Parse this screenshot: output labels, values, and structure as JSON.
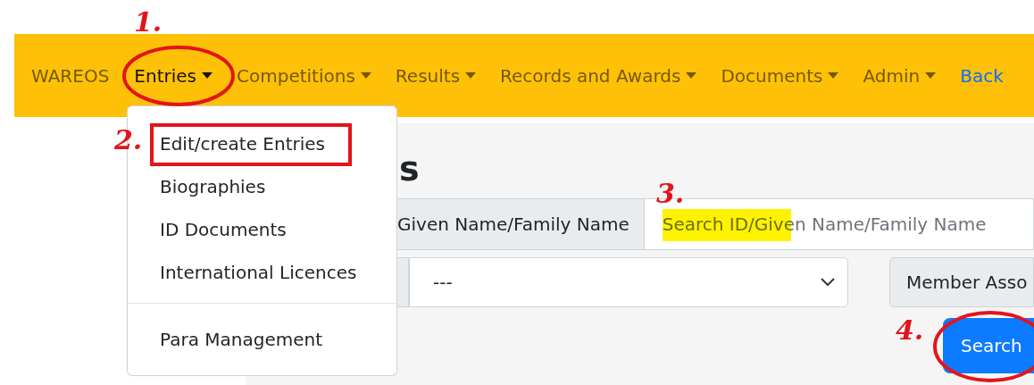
{
  "navbar": {
    "brand": "WAREOS",
    "items": [
      {
        "label": "Entries",
        "kind": "dropdown",
        "selected": true
      },
      {
        "label": "Competitions",
        "kind": "dropdown",
        "selected": false
      },
      {
        "label": "Results",
        "kind": "dropdown",
        "selected": false
      },
      {
        "label": "Records and Awards",
        "kind": "dropdown",
        "selected": false
      },
      {
        "label": "Documents",
        "kind": "dropdown",
        "selected": false
      },
      {
        "label": "Admin",
        "kind": "dropdown",
        "selected": false
      },
      {
        "label": "Back",
        "kind": "link",
        "selected": false
      }
    ]
  },
  "dropdown_menu": {
    "items": [
      {
        "kind": "item",
        "label": "Edit/create Entries"
      },
      {
        "kind": "item",
        "label": "Biographies"
      },
      {
        "kind": "item",
        "label": "ID Documents"
      },
      {
        "kind": "item",
        "label": "International Licences"
      },
      {
        "kind": "divider"
      },
      {
        "kind": "item",
        "label": "Para Management"
      }
    ]
  },
  "page": {
    "heading": "s",
    "search_group": {
      "label": "Given Name/Family Name",
      "placeholder": "Search ID/Given Name/Family Name"
    },
    "filter": {
      "select_value": "---",
      "member_label": "Member Asso"
    },
    "search_button": "Search"
  },
  "annotations": [
    {
      "kind": "number",
      "text": "1."
    },
    {
      "kind": "ellipse"
    },
    {
      "kind": "number",
      "text": "2."
    },
    {
      "kind": "rectangle"
    },
    {
      "kind": "number",
      "text": "3."
    },
    {
      "kind": "highlight"
    },
    {
      "kind": "number",
      "text": "4."
    },
    {
      "kind": "ellipse"
    }
  ]
}
